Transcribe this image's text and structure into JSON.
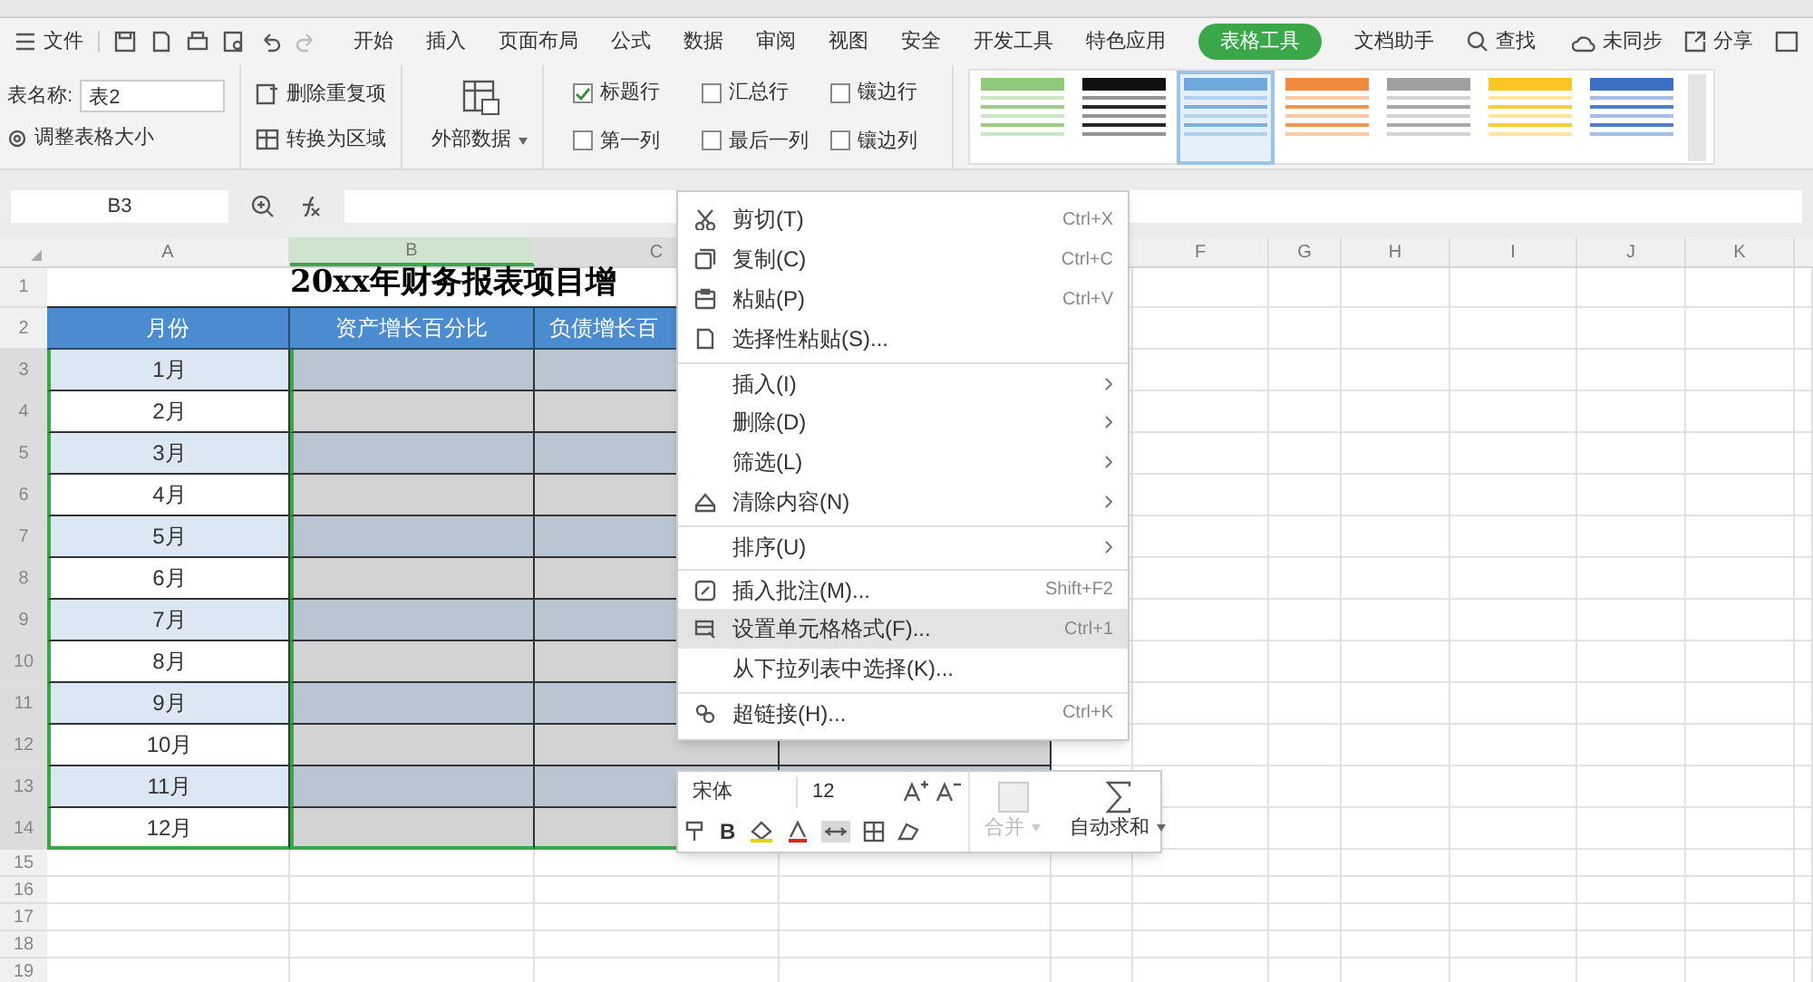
{
  "menu_bar": {
    "file_label": "文件",
    "tabs": [
      {
        "label": "开始",
        "selected": false
      },
      {
        "label": "插入",
        "selected": false
      },
      {
        "label": "页面布局",
        "selected": false
      },
      {
        "label": "公式",
        "selected": false
      },
      {
        "label": "数据",
        "selected": false
      },
      {
        "label": "审阅",
        "selected": false
      },
      {
        "label": "视图",
        "selected": false
      },
      {
        "label": "安全",
        "selected": false
      },
      {
        "label": "开发工具",
        "selected": false
      },
      {
        "label": "特色应用",
        "selected": false
      },
      {
        "label": "表格工具",
        "selected": true
      },
      {
        "label": "文档助手",
        "selected": false
      }
    ],
    "search": "查找",
    "sync": "未同步",
    "share": "分享"
  },
  "ribbon": {
    "table_name_label": "表名称:",
    "table_name_value": "表2",
    "resize": "调整表格大小",
    "remove_duplicates": "删除重复项",
    "convert": "转换为区域",
    "external_data": "外部数据",
    "checkboxes": [
      {
        "label": "标题行",
        "checked": true
      },
      {
        "label": "汇总行",
        "checked": false
      },
      {
        "label": "镶边行",
        "checked": false
      },
      {
        "label": "第一列",
        "checked": false
      },
      {
        "label": "最后一列",
        "checked": false
      },
      {
        "label": "镶边列",
        "checked": false
      }
    ],
    "styles": [
      {
        "color": "#8fc97a",
        "selected": false
      },
      {
        "color": "#111111",
        "selected": false
      },
      {
        "color": "#6fa8dc",
        "selected": true
      },
      {
        "color": "#f08a3c",
        "selected": false
      },
      {
        "color": "#a0a0a0",
        "selected": false
      },
      {
        "color": "#f9c623",
        "selected": false
      },
      {
        "color": "#3c6fc4",
        "selected": false
      }
    ]
  },
  "formula_bar": {
    "name_box": "B3"
  },
  "sheet": {
    "columns": [
      {
        "label": "A",
        "selected": false
      },
      {
        "label": "B",
        "selected": true
      },
      {
        "label": "C",
        "selected": true
      },
      {
        "label": "F",
        "selected": false
      },
      {
        "label": "G",
        "selected": false
      },
      {
        "label": "H",
        "selected": false
      },
      {
        "label": "I",
        "selected": false
      },
      {
        "label": "J",
        "selected": false
      },
      {
        "label": "K",
        "selected": false
      }
    ],
    "row_numbers": [
      {
        "label": "1",
        "selected": false
      },
      {
        "label": "2",
        "selected": false
      },
      {
        "label": "3",
        "selected": true
      },
      {
        "label": "4",
        "selected": true
      },
      {
        "label": "5",
        "selected": true
      },
      {
        "label": "6",
        "selected": true
      },
      {
        "label": "7",
        "selected": true
      },
      {
        "label": "8",
        "selected": true
      },
      {
        "label": "9",
        "selected": true
      },
      {
        "label": "10",
        "selected": true
      },
      {
        "label": "11",
        "selected": true
      },
      {
        "label": "12",
        "selected": true
      },
      {
        "label": "13",
        "selected": true
      },
      {
        "label": "14",
        "selected": true
      },
      {
        "label": "15",
        "selected": false
      },
      {
        "label": "16",
        "selected": false
      },
      {
        "label": "17",
        "selected": false
      },
      {
        "label": "18",
        "selected": false
      },
      {
        "label": "19",
        "selected": false
      }
    ],
    "title": "20xx年财务报表项目增",
    "headers": [
      "月份",
      "资产增长百分比",
      "负债增长百"
    ],
    "months": [
      "1月",
      "2月",
      "3月",
      "4月",
      "5月",
      "6月",
      "7月",
      "8月",
      "9月",
      "10月",
      "11月",
      "12月"
    ]
  },
  "context_menu": [
    {
      "kind": "scissors",
      "label": "剪切(T)",
      "shortcut": "Ctrl+X",
      "submenu": false,
      "divider_before": false,
      "selected": false
    },
    {
      "kind": "copy",
      "label": "复制(C)",
      "shortcut": "Ctrl+C",
      "submenu": false,
      "divider_before": false,
      "selected": false
    },
    {
      "kind": "paste",
      "label": "粘贴(P)",
      "shortcut": "Ctrl+V",
      "submenu": false,
      "divider_before": false,
      "selected": false
    },
    {
      "kind": "paste-special",
      "label": "选择性粘贴(S)...",
      "submenu": false,
      "divider_before": false,
      "selected": false
    },
    {
      "kind": "none",
      "label": "插入(I)",
      "submenu": true,
      "divider_before": true,
      "selected": false
    },
    {
      "kind": "none",
      "label": "删除(D)",
      "submenu": true,
      "divider_before": false,
      "selected": false
    },
    {
      "kind": "none",
      "label": "筛选(L)",
      "submenu": true,
      "divider_before": false,
      "selected": false
    },
    {
      "kind": "eraser",
      "label": "清除内容(N)",
      "submenu": true,
      "divider_before": false,
      "selected": false
    },
    {
      "kind": "none",
      "label": "排序(U)",
      "submenu": true,
      "divider_before": true,
      "selected": false
    },
    {
      "kind": "comment",
      "label": "插入批注(M)...",
      "shortcut": "Shift+F2",
      "submenu": false,
      "divider_before": true,
      "selected": false
    },
    {
      "kind": "format",
      "label": "设置单元格格式(F)...",
      "shortcut": "Ctrl+1",
      "submenu": false,
      "divider_before": false,
      "selected": true
    },
    {
      "kind": "none",
      "label": "从下拉列表中选择(K)...",
      "submenu": false,
      "divider_before": false,
      "selected": false
    },
    {
      "kind": "link",
      "label": "超链接(H)...",
      "shortcut": "Ctrl+K",
      "submenu": false,
      "divider_before": true,
      "selected": false
    }
  ],
  "mini_toolbar": {
    "font": "宋体",
    "size": "12",
    "bold_label": "B",
    "merge": {
      "label": "合并",
      "disabled": true
    },
    "autosum": "自动求和"
  }
}
